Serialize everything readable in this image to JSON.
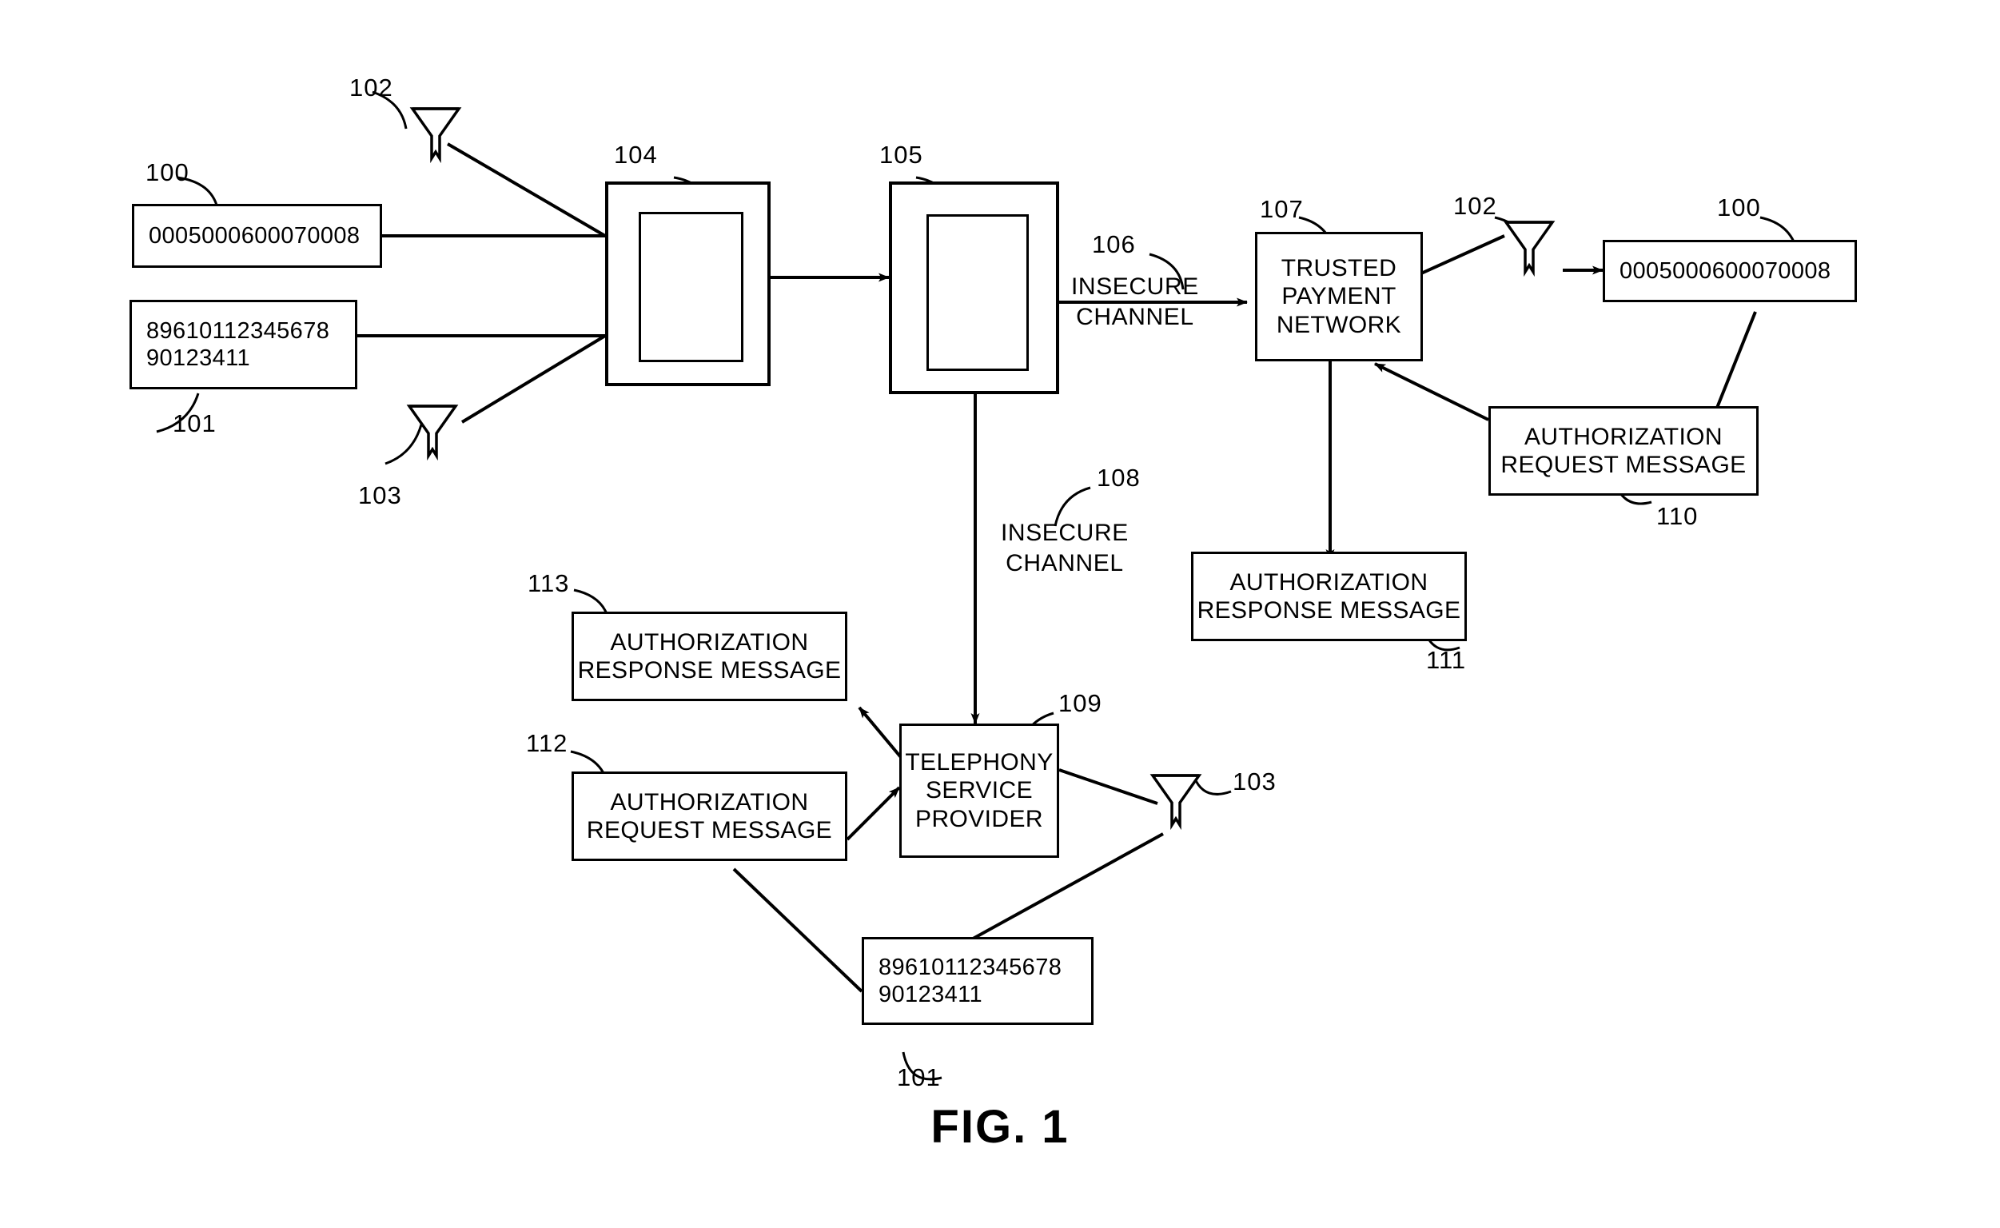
{
  "figure": {
    "caption": "FIG. 1",
    "title": "FIG. 1"
  },
  "nodes": {
    "pan_left": {
      "ref": "100",
      "line1": "0005000600070008"
    },
    "iccid_left": {
      "ref": "101",
      "line1": "89610112345678",
      "line2": "90123411"
    },
    "antenna_102_top": {
      "ref": "102",
      "icon": "antenna-icon"
    },
    "antenna_103_left": {
      "ref": "103",
      "icon": "antenna-icon"
    },
    "device_104": {
      "ref": "104"
    },
    "device_105": {
      "ref": "105"
    },
    "insecure_channel_106": {
      "ref": "106",
      "line1": "INSECURE",
      "line2": "CHANNEL"
    },
    "trusted_payment_network_107": {
      "ref": "107",
      "line1": "TRUSTED",
      "line2": "PAYMENT",
      "line3": "NETWORK"
    },
    "antenna_102_right": {
      "ref": "102",
      "icon": "antenna-icon"
    },
    "pan_right": {
      "ref": "100",
      "line1": "0005000600070008"
    },
    "auth_request_110": {
      "ref": "110",
      "line1": "AUTHORIZATION",
      "line2": "REQUEST MESSAGE"
    },
    "auth_response_111": {
      "ref": "111",
      "line1": "AUTHORIZATION",
      "line2": "RESPONSE MESSAGE"
    },
    "insecure_channel_108": {
      "ref": "108",
      "line1": "INSECURE",
      "line2": "CHANNEL"
    },
    "telephony_service_provider_109": {
      "ref": "109",
      "line1": "TELEPHONY",
      "line2": "SERVICE",
      "line3": "PROVIDER"
    },
    "auth_response_113": {
      "ref": "113",
      "line1": "AUTHORIZATION",
      "line2": "RESPONSE MESSAGE"
    },
    "auth_request_112": {
      "ref": "112",
      "line1": "AUTHORIZATION",
      "line2": "REQUEST MESSAGE"
    },
    "iccid_bottom": {
      "ref": "101",
      "line1": "89610112345678",
      "line2": "90123411"
    },
    "antenna_103_bottom": {
      "ref": "103",
      "icon": "antenna-icon"
    }
  },
  "colors": {
    "stroke": "#000000",
    "background": "#ffffff"
  }
}
